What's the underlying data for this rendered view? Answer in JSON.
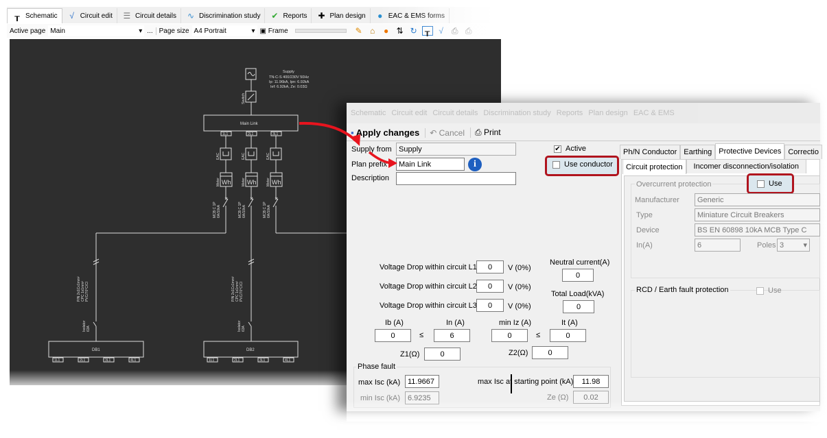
{
  "main_window": {
    "tabs": [
      {
        "label": "Schematic",
        "icon": "schematic-icon"
      },
      {
        "label": "Circuit edit",
        "icon": "circuit-edit-icon"
      },
      {
        "label": "Circuit details",
        "icon": "list-icon"
      },
      {
        "label": "Discrimination study",
        "icon": "curves-icon"
      },
      {
        "label": "Reports",
        "icon": "report-check-icon"
      },
      {
        "label": "Plan design",
        "icon": "plan-design-icon"
      },
      {
        "label": "EAC & EMS forms",
        "icon": "globe-icon"
      }
    ],
    "active_tab": "Schematic",
    "toolbar": {
      "active_page_label": "Active page",
      "active_page_value": "Main",
      "more_label": "...",
      "page_size_label": "Page size",
      "page_size_value": "A4 Portrait",
      "frame_label": "Frame"
    }
  },
  "schematic": {
    "supply": {
      "title": "Supply",
      "line1": "TN-C-S 400/230V 50Hz",
      "line2": "Ip: 11.96kA, Ipn: 6.92kA",
      "line3": "Ief: 6.92kA, Ze: 0.03Ω"
    },
    "switch_label": "Switch",
    "main_link": "Main Link",
    "main_ports": [
      "1L1",
      "2L1",
      "3L1"
    ],
    "eac_label": "EAC",
    "meter_label": "Meter",
    "meter_symbol": "Wh",
    "mcb_label1": "MCB C 1P",
    "mcb_label2": "6A/10kA",
    "cable_label1": "P/N 2x1Cx1mm²",
    "cable_label2": "CPC 1x1mm²",
    "cable_label3": "PVC/70°C/Cl",
    "isolator_label1": "Isolator",
    "isolator_label2": "63A",
    "boards": [
      {
        "name": "DB1",
        "ports": [
          "1L1",
          "2L1",
          "3L1",
          "4L1"
        ]
      },
      {
        "name": "DB2",
        "ports": [
          "1L1",
          "2L1",
          "3L1",
          "4L1"
        ]
      }
    ]
  },
  "dialog": {
    "ghost_tabs": [
      "Schematic",
      "Circuit edit",
      "Circuit details",
      "Discrimination study",
      "Reports",
      "Plan design",
      "EAC & EMS"
    ],
    "toolbar": {
      "apply": "Apply changes",
      "cancel": "Cancel",
      "print": "Print"
    },
    "supply_from_label": "Supply from",
    "supply_from_value": "Supply",
    "plan_prefix_label": "Plan prefix",
    "plan_prefix_value": "Main Link",
    "description_label": "Description",
    "description_value": "",
    "active_label": "Active",
    "active_checked": true,
    "use_conductor_label": "Use conductor",
    "use_conductor_checked": false,
    "tabs": [
      "Ph/N Conductor",
      "Earthing",
      "Protective Devices",
      "Correctio"
    ],
    "active_tab": "Protective Devices",
    "subtabs": [
      "Circuit protection",
      "Incomer disconnection/isolation"
    ],
    "overcurrent": {
      "title": "Overcurrent protection",
      "use_label": "Use",
      "use_checked": false,
      "manufacturer_label": "Manufacturer",
      "manufacturer": "Generic",
      "type_label": "Type",
      "type": "Miniature Circuit Breakers",
      "device_label": "Device",
      "device": "BS EN 60898 10kA MCB Type C",
      "in_label": "In(A)",
      "in": "6",
      "poles_label": "Poles",
      "poles": "3"
    },
    "rcd": {
      "title": "RCD / Earth fault protection",
      "use_label": "Use",
      "use_checked": false
    },
    "vd": [
      {
        "label": "Voltage Drop within circuit L1",
        "value": "0",
        "unit": "V (0%)"
      },
      {
        "label": "Voltage Drop within circuit L2",
        "value": "0",
        "unit": "V (0%)"
      },
      {
        "label": "Voltage Drop within circuit L3",
        "value": "0",
        "unit": "V (0%)"
      }
    ],
    "neutral_current_label": "Neutral current(A)",
    "neutral_current": "0",
    "total_load_label": "Total Load(kVA)",
    "total_load": "0",
    "ib_label": "Ib (A)",
    "ib": "0",
    "in_label": "In (A)",
    "in": "6",
    "leq": "≤",
    "min_iz_label": "min Iz (A)",
    "min_iz": "0",
    "it_label": "It (A)",
    "it": "0",
    "z1_label": "Z1(Ω)",
    "z1": "0",
    "z2_label": "Z2(Ω)",
    "z2": "0",
    "phase_fault_label": "Phase fault",
    "max_isc_label": "max Isc (kA)",
    "max_isc": "11.9667",
    "max_isc_start_label": "max Isc at starting point (kA)",
    "max_isc_start": "11.98",
    "min_isc_label": "min Isc (kA)",
    "min_isc": "6.9235",
    "ze_label": "Ze (Ω)",
    "ze": "0.02"
  },
  "colors": {
    "canvas": "#2e2e2e",
    "annotation": "#b0141e",
    "arrow": "#e8141e"
  }
}
